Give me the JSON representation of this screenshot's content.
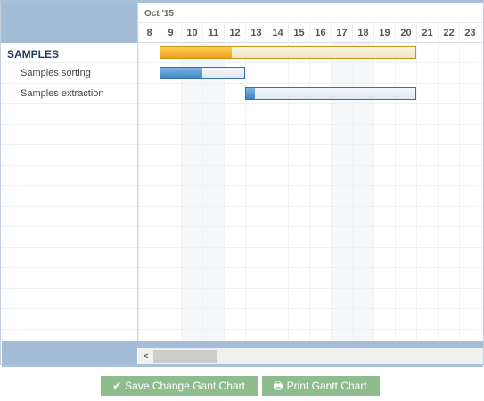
{
  "timeline": {
    "month": "Oct '15",
    "days": [
      "8",
      "9",
      "10",
      "11",
      "12",
      "13",
      "14",
      "15",
      "16",
      "17",
      "18",
      "19",
      "20",
      "21",
      "22",
      "23"
    ],
    "weekend_days": [
      "10",
      "11",
      "17",
      "18"
    ]
  },
  "tasks": [
    {
      "label": "SAMPLES",
      "type": "group",
      "start_day": "9",
      "end_day": "20",
      "progress": 0.28
    },
    {
      "label": "Samples sorting",
      "type": "task",
      "start_day": "9",
      "end_day": "12",
      "progress": 0.5
    },
    {
      "label": "Samples extraction",
      "type": "task",
      "start_day": "13",
      "end_day": "20",
      "progress": 0.05
    }
  ],
  "scrollbar": {
    "left_arrow": "<"
  },
  "buttons": {
    "save": {
      "label": "Save Change Gant Chart",
      "icon": "checkmark-icon"
    },
    "print": {
      "label": "Print Gantt Chart",
      "icon": "printer-icon"
    }
  },
  "colors": {
    "header_blue": "#a3bdd6",
    "group_bar": "#f0a21a",
    "task_bar": "#3d85c6",
    "button_green": "#8fbc8f"
  }
}
